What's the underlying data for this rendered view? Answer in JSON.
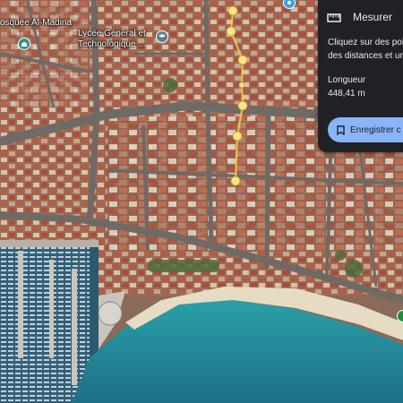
{
  "map": {
    "labels": [
      "osquée Al-Madina",
      "Lycée Général et",
      "Technologique ..."
    ]
  },
  "measure_panel": {
    "title": "Mesurer",
    "description_line1": "Cliquez sur des poi",
    "description_line2": "des distances et ur",
    "length_label": "Longueur",
    "length_value": "448,41 m",
    "save_button_label": "Enregistrer c",
    "accent_color": "#8ab4f8",
    "panel_color": "#202124"
  },
  "route": {
    "color": "#f4c542",
    "point_color": "#f7e58c"
  }
}
